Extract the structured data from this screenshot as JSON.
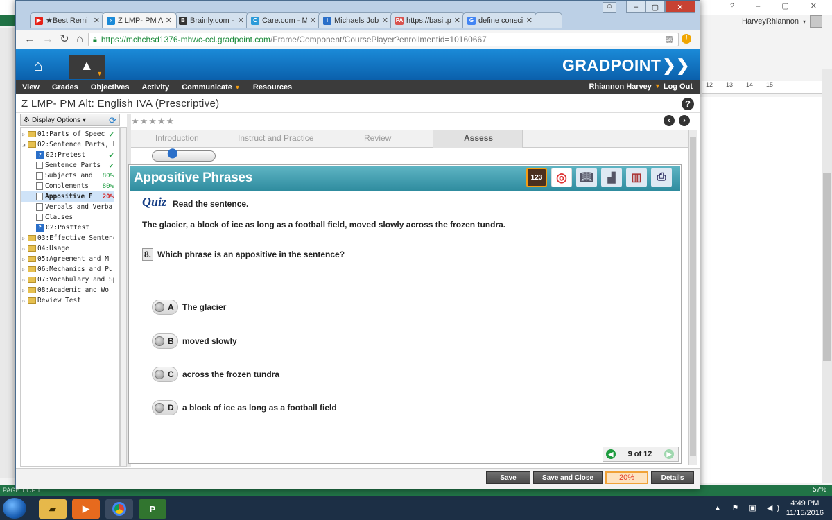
{
  "word": {
    "user_name": "HarveyRhiannon",
    "window_controls": "?   –   ▢   ✕",
    "ruler_marks": "12 · · · 13 · · · 14 · · · 15",
    "status_left": "PAGE 1 OF 1",
    "zoom_label": "57%"
  },
  "browser": {
    "tabs": [
      {
        "title": "★Best Remi",
        "favicon_color": "#e62117",
        "favicon_letter": "▶"
      },
      {
        "title": "Z LMP- PM Alt",
        "favicon_color": "#1b8ad8",
        "favicon_letter": "›"
      },
      {
        "title": "Brainly.com - F",
        "favicon_color": "#333333",
        "favicon_letter": "B"
      },
      {
        "title": "Care.com - My",
        "favicon_color": "#2d9bd9",
        "favicon_letter": "C"
      },
      {
        "title": "Michaels Jobs,",
        "favicon_color": "#2a6fc9",
        "favicon_letter": "i"
      },
      {
        "title": "https://basil.pe",
        "favicon_color": "#d9534f",
        "favicon_letter": "PA"
      },
      {
        "title": "define conscien",
        "favicon_color": "#4285f4",
        "favicon_letter": "G"
      }
    ],
    "url_host": "https://mchchsd1376-mhwc-ccl.gradpoint.com",
    "url_path": "/Frame/Component/CoursePlayer?enrollmentid=10160667"
  },
  "app": {
    "logo": "GRADPOINT",
    "menu": [
      "View",
      "Grades",
      "Objectives",
      "Activity",
      "Communicate",
      "Resources"
    ],
    "user": "Rhiannon Harvey",
    "logout": "Log Out",
    "course_title": "Z LMP- PM Alt: English IVA (Prescriptive)",
    "display_options": "Display Options"
  },
  "tree": [
    {
      "label": "01:Parts of Speec",
      "type": "folder",
      "expand": "▷",
      "indent": 0,
      "check": true
    },
    {
      "label": "02:Sentence Parts, Pl",
      "type": "folder",
      "expand": "◢",
      "indent": 0
    },
    {
      "label": "02:Pretest",
      "type": "quiz",
      "indent": 1,
      "check": true
    },
    {
      "label": "Sentence Parts",
      "type": "page",
      "indent": 1,
      "check": true
    },
    {
      "label": "Subjects and",
      "type": "page",
      "indent": 1,
      "pct": "80%"
    },
    {
      "label": "Complements",
      "type": "page",
      "indent": 1,
      "pct": "80%"
    },
    {
      "label": "Appositive F",
      "type": "page",
      "indent": 1,
      "pct": "20%",
      "pct_red": true,
      "selected": true
    },
    {
      "label": "Verbals and Verba",
      "type": "page",
      "indent": 1
    },
    {
      "label": "Clauses",
      "type": "page",
      "indent": 1
    },
    {
      "label": "02:Posttest",
      "type": "quiz",
      "indent": 1
    },
    {
      "label": "03:Effective Sentence",
      "type": "folder",
      "expand": "▷",
      "indent": 0
    },
    {
      "label": "04:Usage",
      "type": "folder",
      "expand": "▷",
      "indent": 0
    },
    {
      "label": "05:Agreement and M",
      "type": "folder",
      "expand": "▷",
      "indent": 0
    },
    {
      "label": "06:Mechanics and Pu",
      "type": "folder",
      "expand": "▷",
      "indent": 0
    },
    {
      "label": "07:Vocabulary and Sp",
      "type": "folder",
      "expand": "▷",
      "indent": 0
    },
    {
      "label": "08:Academic and Wo",
      "type": "folder",
      "expand": "▷",
      "indent": 0
    },
    {
      "label": "Review Test",
      "type": "folder",
      "expand": "▷",
      "indent": 0
    }
  ],
  "lesson": {
    "tabs": [
      "Introduction",
      "Instruct and Practice",
      "Review",
      "Assess"
    ],
    "active_tab": "Assess",
    "title": "Appositive Phrases",
    "tools": [
      "123",
      "target",
      "book",
      "chart",
      "books",
      "printer"
    ],
    "quiz_label": "Quiz",
    "instruction": "Read the sentence.",
    "sentence": "The glacier, a block of ice as long as a football field, moved slowly across the frozen tundra.",
    "question_number": "8.",
    "question": "Which phrase is an appositive in the sentence?",
    "options": [
      {
        "letter": "A",
        "text": "The glacier"
      },
      {
        "letter": "B",
        "text": "moved slowly"
      },
      {
        "letter": "C",
        "text": "across the frozen tundra"
      },
      {
        "letter": "D",
        "text": "a block of ice as long as a football field"
      }
    ],
    "pager": "9 of 12"
  },
  "footer": {
    "save": "Save",
    "save_close": "Save and Close",
    "progress": "20%",
    "details": "Details"
  },
  "taskbar": {
    "time": "4:49 PM",
    "date": "11/15/2016"
  },
  "colors": {
    "accent_blue": "#1b8ad8",
    "banner_teal": "#3a9aab",
    "progress_red": "#e2402a"
  }
}
